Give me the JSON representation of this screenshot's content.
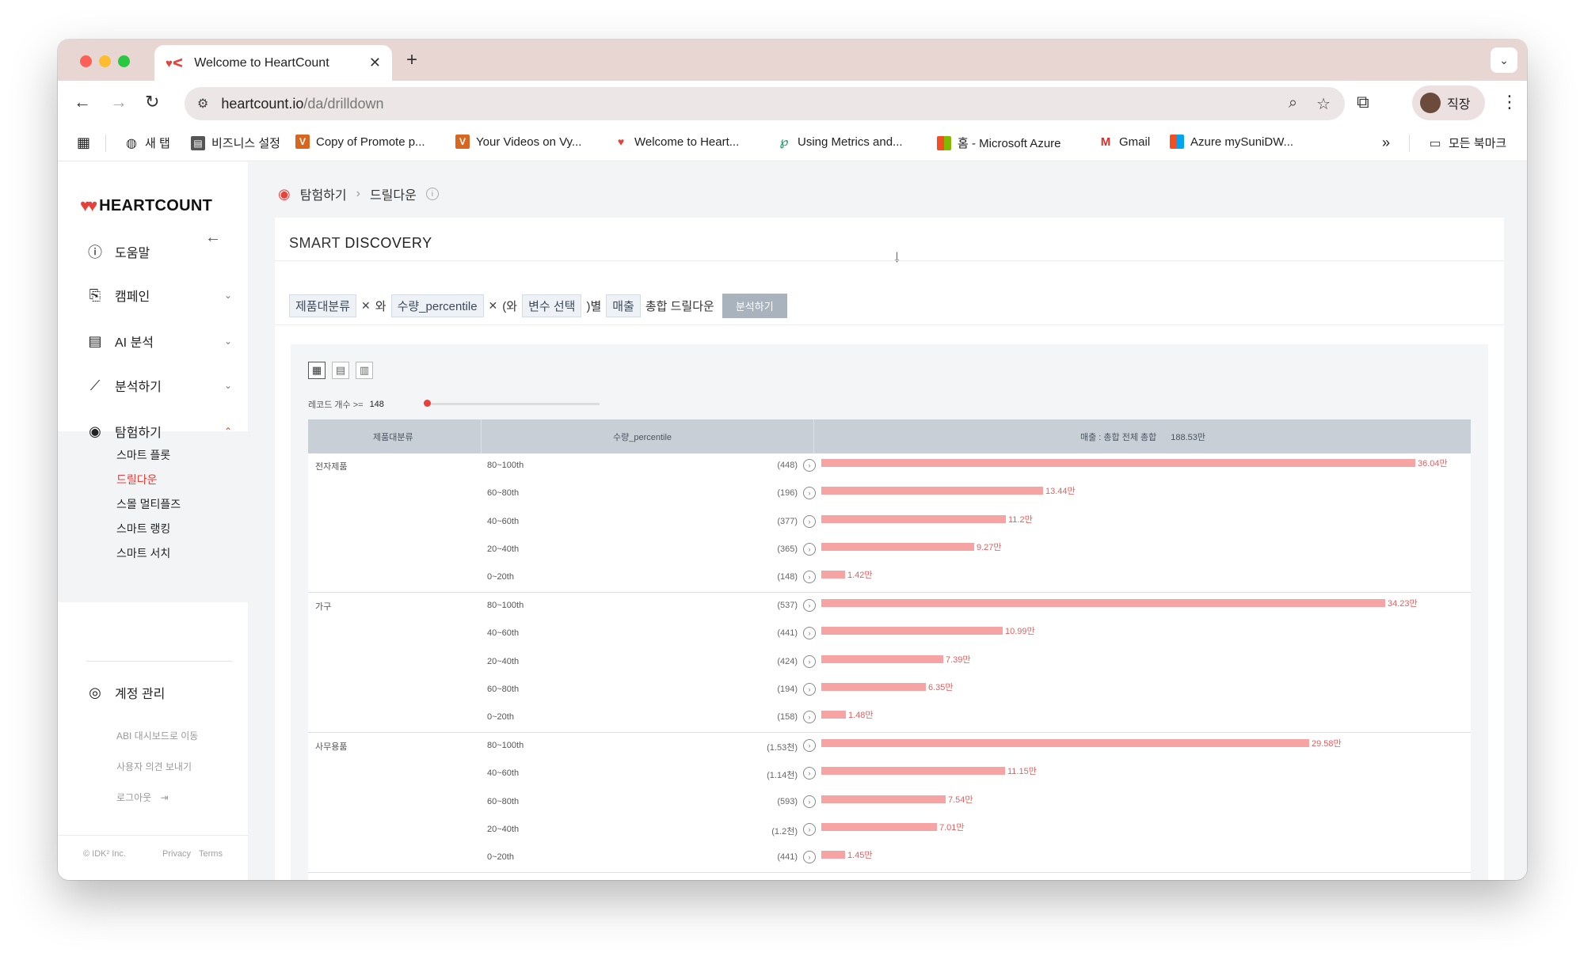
{
  "browser": {
    "tab_title": "Welcome to HeartCount",
    "url_host": "heartcount.io",
    "url_path": "/da/drilldown",
    "profile_name": "직장",
    "bookmarks": [
      {
        "label": "새 탭",
        "color": "#333333"
      },
      {
        "label": "비즈니스 설정",
        "color": "#555555"
      },
      {
        "label": "Copy of Promote p...",
        "color": "#d9661f"
      },
      {
        "label": "Your Videos on Vy...",
        "color": "#d9661f"
      },
      {
        "label": "Welcome to Heart...",
        "color": "#e8403a"
      },
      {
        "label": "Using Metrics and...",
        "color": "#2a9d6a"
      },
      {
        "label": "홈 - Microsoft Azure",
        "color": "#0078d4"
      },
      {
        "label": "Gmail",
        "color": "#d93025"
      },
      {
        "label": "Azure mySuniDW...",
        "color": "#0078d4"
      }
    ],
    "all_bookmarks": "모든 북마크"
  },
  "sidebar": {
    "logo": "HEARTCOUNT",
    "items": [
      {
        "label": "도움말",
        "icon": "info-icon"
      },
      {
        "label": "캠페인",
        "icon": "campaign-icon"
      },
      {
        "label": "AI 분석",
        "icon": "chat-icon"
      },
      {
        "label": "분석하기",
        "icon": "analytics-icon"
      },
      {
        "label": "탐험하기",
        "icon": "eye-icon"
      }
    ],
    "sub_items": [
      "스마트 플롯",
      "드릴다운",
      "스몰 멀티플즈",
      "스마트 랭킹",
      "스마트 서치"
    ],
    "account": "계정 관리",
    "links": [
      "ABI 대시보드로 이동",
      "사용자 의견 보내기",
      "로그아웃"
    ],
    "footer_copyright": "© IDK² Inc.",
    "footer_privacy": "Privacy",
    "footer_terms": "Terms"
  },
  "breadcrumb": {
    "parent": "탐험하기",
    "current": "드릴다운"
  },
  "card": {
    "title_a": "SMART",
    "title_b": "DISCOVERY",
    "query": {
      "chip1": "제품대분류",
      "and1": "와",
      "chip2": "수량_percentile",
      "and2": "(와",
      "chip3": "변수 선택",
      "by": ")별",
      "chip4": "매출",
      "suffix": "총합 드릴다운",
      "button": "분석하기"
    }
  },
  "table": {
    "record_filter_label": "레코드 개수 >=",
    "record_filter_value": "148",
    "headers": {
      "col1": "제품대분류",
      "col2": "수량_percentile",
      "col3": "매출 : 총합 전체 총합",
      "col3_total": "188.53만"
    },
    "max_value": 36.04,
    "groups": [
      {
        "category": "전자제품",
        "rows": [
          {
            "pct": "80~100th",
            "count": "(448)",
            "value": 36.04,
            "label": "36.04만"
          },
          {
            "pct": "60~80th",
            "count": "(196)",
            "value": 13.44,
            "label": "13.44만"
          },
          {
            "pct": "40~60th",
            "count": "(377)",
            "value": 11.2,
            "label": "11.2만"
          },
          {
            "pct": "20~40th",
            "count": "(365)",
            "value": 9.27,
            "label": "9.27만"
          },
          {
            "pct": "0~20th",
            "count": "(148)",
            "value": 1.42,
            "label": "1.42만"
          }
        ]
      },
      {
        "category": "가구",
        "rows": [
          {
            "pct": "80~100th",
            "count": "(537)",
            "value": 34.23,
            "label": "34.23만"
          },
          {
            "pct": "40~60th",
            "count": "(441)",
            "value": 10.99,
            "label": "10.99만"
          },
          {
            "pct": "20~40th",
            "count": "(424)",
            "value": 7.39,
            "label": "7.39만"
          },
          {
            "pct": "60~80th",
            "count": "(194)",
            "value": 6.35,
            "label": "6.35만"
          },
          {
            "pct": "0~20th",
            "count": "(158)",
            "value": 1.48,
            "label": "1.48만"
          }
        ]
      },
      {
        "category": "사무용품",
        "rows": [
          {
            "pct": "80~100th",
            "count": "(1.53천)",
            "value": 29.58,
            "label": "29.58만"
          },
          {
            "pct": "40~60th",
            "count": "(1.14천)",
            "value": 11.15,
            "label": "11.15만"
          },
          {
            "pct": "60~80th",
            "count": "(593)",
            "value": 7.54,
            "label": "7.54만"
          },
          {
            "pct": "20~40th",
            "count": "(1.2천)",
            "value": 7.01,
            "label": "7.01만"
          },
          {
            "pct": "0~20th",
            "count": "(441)",
            "value": 1.45,
            "label": "1.45만"
          }
        ]
      }
    ]
  }
}
